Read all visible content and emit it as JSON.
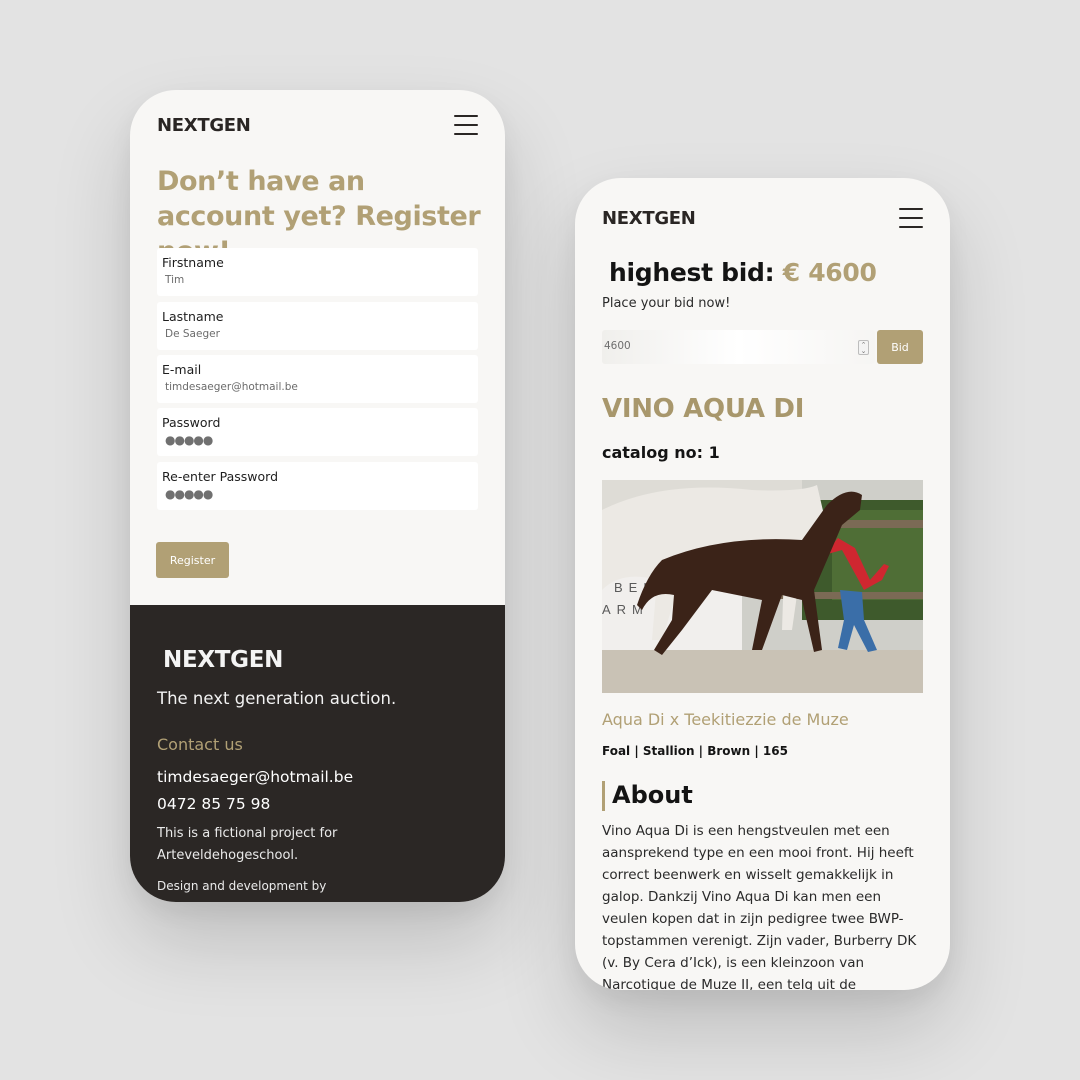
{
  "brand": "NEXTGEN",
  "colors": {
    "accent": "#b1a075",
    "dark": "#2b2725",
    "background": "#e3e3e3",
    "screen": "#f8f7f5"
  },
  "register_screen": {
    "title": "Don’t have an account yet? Register now!",
    "fields": [
      {
        "label": "Firstname",
        "value": "Tim",
        "type": "text"
      },
      {
        "label": "Lastname",
        "value": "De Saeger",
        "type": "text"
      },
      {
        "label": "E-mail",
        "value": "timdesaeger@hotmail.be",
        "type": "email"
      },
      {
        "label": "Password",
        "value": "●●●●●",
        "type": "password"
      },
      {
        "label": "Re-enter Password",
        "value": "●●●●●",
        "type": "password"
      }
    ],
    "register_button": "Register",
    "footer": {
      "logo": "NEXTGEN",
      "tagline": "The next generation auction.",
      "contact_heading": "Contact us",
      "email": "timdesaeger@hotmail.be",
      "phone": "0472 85 75 98",
      "note": "This is a fictional project for Arteveldehogeschool.",
      "credit": "Design and development by"
    }
  },
  "auction_screen": {
    "highest_bid_label": "highest bid: ",
    "highest_bid_amount": "€ 4600",
    "bid_prompt": "Place your bid now!",
    "bid_input_value": "4600",
    "bid_button": "Bid",
    "horse_name": "VINO AQUA DI",
    "catalog": "catalog no: 1",
    "image_icon": "horse-photo",
    "pedigree": "Aqua Di x Teekitiezzie de Muze",
    "specs": "Foal | Stallion | Brown | 165",
    "about_heading": "About",
    "about_text": "Vino Aqua Di is een hengstveulen met een aansprekend type en een mooi front. Hij heeft correct beenwerk en wisselt gemakkelijk in galop. Dankzij Vino Aqua Di kan men een veulen kopen dat in zijn pedigree twee BWP-topstammen verenigt. Zijn vader, Burberry DK (v. By Cera d’Ick), is een kleinzoon van Narcotique de Muze II, een telg uit de"
  }
}
